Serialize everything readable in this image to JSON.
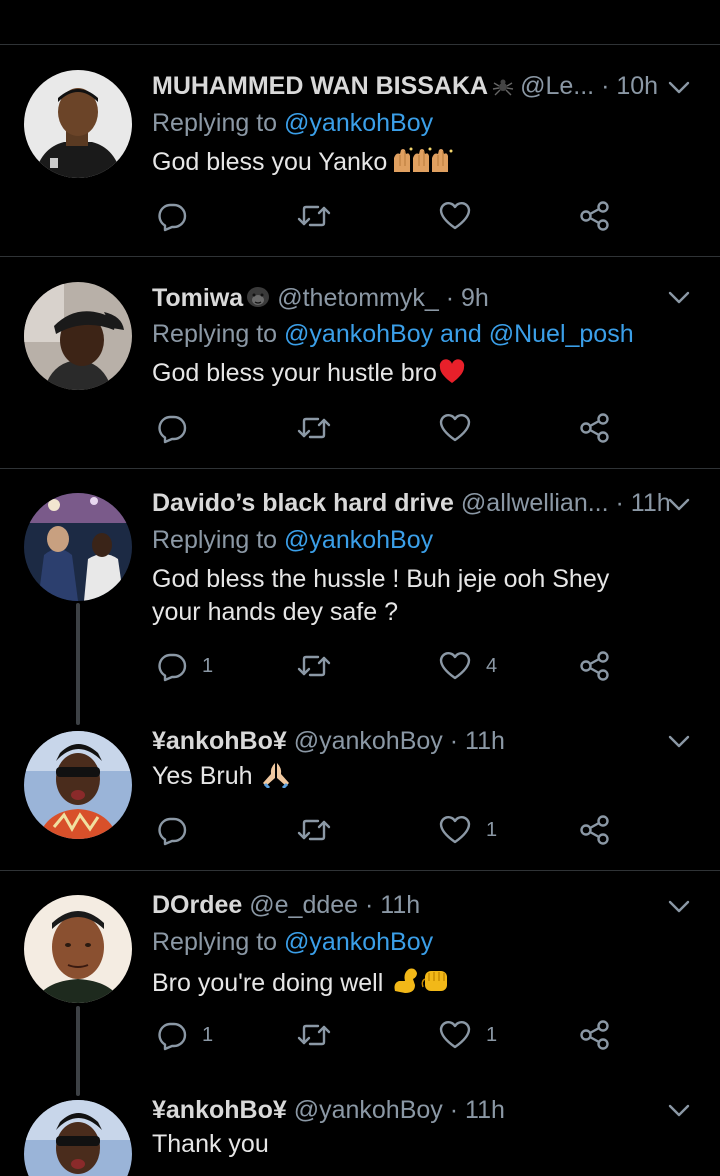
{
  "tweets": [
    {
      "name": "MUHAMMED WAN BISSAKA",
      "badge": "spider-icon",
      "handle": "@Le...",
      "time": "· 10h",
      "replying_prefix": "Replying to ",
      "mentions": "@yankohBoy",
      "text": "God bless you Yanko",
      "emoji": "raising-hands-emoji",
      "reply_count": "",
      "like_count": ""
    },
    {
      "name": "Tomiwa",
      "badge": "gorilla-icon",
      "handle": "@thetommyk_",
      "time": "· 9h",
      "replying_prefix": "Replying to ",
      "mentions": "@yankohBoy and @Nuel_posh",
      "text": "God bless your hustle bro",
      "emoji": "red-heart-emoji",
      "reply_count": "",
      "like_count": ""
    },
    {
      "name": "Davido’s black hard drive",
      "handle": "@allwellian...",
      "time": "· 11h",
      "replying_prefix": "Replying to ",
      "mentions": "@yankohBoy",
      "text": "God bless the hussle ! Buh jeje ooh Shey your hands dey safe ?",
      "reply_count": "1",
      "like_count": "4"
    },
    {
      "name": "¥ankohBo¥",
      "handle": "@yankohBoy",
      "time": "· 11h",
      "text": "Yes Bruh",
      "emoji": "folded-hands-emoji",
      "reply_count": "",
      "like_count": "1"
    },
    {
      "name": "DOrdee",
      "handle": "@e_ddee",
      "time": "· 11h",
      "replying_prefix": "Replying to ",
      "mentions": "@yankohBoy",
      "text": "Bro you're doing well",
      "emoji": "flexed-biceps-fist-emoji",
      "reply_count": "1",
      "like_count": "1"
    },
    {
      "name": "¥ankohBo¥",
      "handle": "@yankohBoy",
      "time": "· 11h",
      "text": "Thank you"
    }
  ],
  "colors": {
    "background": "#000000",
    "text": "#d9d9d9",
    "secondary": "#8b98a5",
    "link": "#3b9fe8",
    "divider": "#2f3336"
  }
}
